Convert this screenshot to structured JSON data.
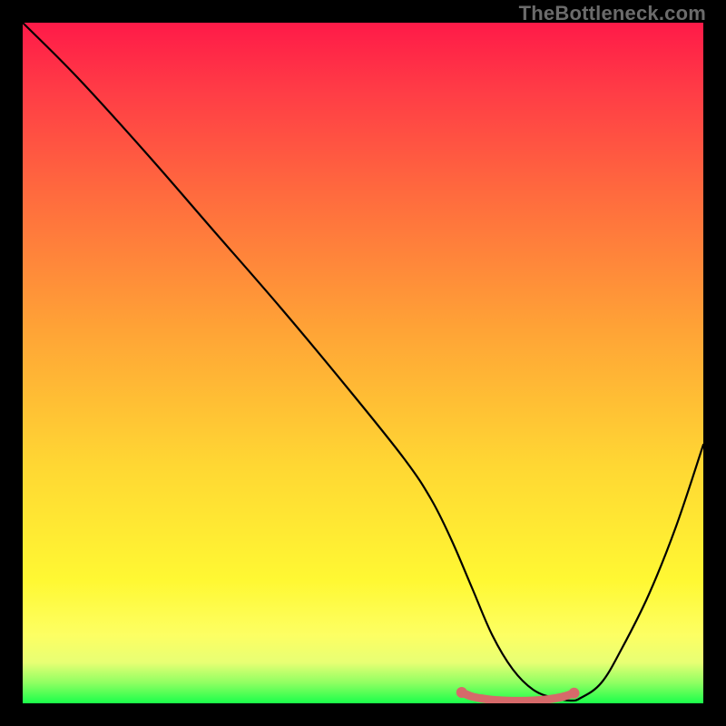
{
  "watermark": "TheBottleneck.com",
  "chart_data": {
    "type": "line",
    "title": "",
    "xlabel": "",
    "ylabel": "",
    "xlim": [
      0,
      100
    ],
    "ylim": [
      0,
      100
    ],
    "grid": false,
    "series": [
      {
        "name": "bottleneck-curve",
        "color": "#000000",
        "x": [
          0,
          8,
          18,
          28,
          38,
          48,
          56,
          60,
          63,
          66,
          69,
          72,
          75,
          78,
          80.5,
          82,
          85,
          88,
          92,
          96,
          100
        ],
        "y": [
          100,
          92,
          81,
          69.5,
          58,
          46,
          36,
          30,
          24,
          17,
          10,
          5,
          2,
          0.8,
          0.4,
          0.8,
          3,
          8,
          16,
          26,
          38
        ]
      },
      {
        "name": "bottleneck-highlight",
        "color": "#d66a6a",
        "x": [
          64.5,
          66,
          67.5,
          69,
          70.5,
          72,
          73.5,
          75,
          76.5,
          78,
          79.5,
          81
        ],
        "y": [
          1.6,
          1.0,
          0.7,
          0.5,
          0.4,
          0.35,
          0.35,
          0.4,
          0.5,
          0.7,
          1.0,
          1.5
        ]
      }
    ],
    "gradient_stops": [
      {
        "offset": 0,
        "color": "#ff1a48"
      },
      {
        "offset": 10,
        "color": "#ff3c46"
      },
      {
        "offset": 25,
        "color": "#ff6a3e"
      },
      {
        "offset": 45,
        "color": "#ffa336"
      },
      {
        "offset": 65,
        "color": "#ffd733"
      },
      {
        "offset": 82,
        "color": "#fff833"
      },
      {
        "offset": 90,
        "color": "#fdff63"
      },
      {
        "offset": 94,
        "color": "#e8ff74"
      },
      {
        "offset": 97,
        "color": "#8fff62"
      },
      {
        "offset": 100,
        "color": "#1aff4a"
      }
    ]
  }
}
